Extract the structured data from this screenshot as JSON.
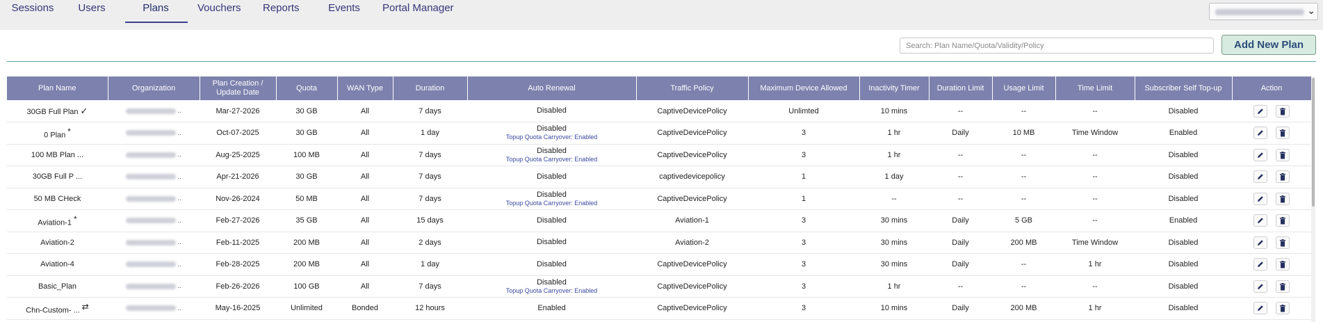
{
  "nav": {
    "tabs": [
      {
        "label": "Sessions",
        "active": false
      },
      {
        "label": "Users",
        "active": false
      },
      {
        "label": "Plans",
        "active": true
      },
      {
        "label": "Vouchers",
        "active": false
      },
      {
        "label": "Reports",
        "active": false
      },
      {
        "label": "Events",
        "active": false
      },
      {
        "label": "Portal Manager",
        "active": false
      }
    ],
    "org_select_icon": "chevron-down-icon"
  },
  "toolbar": {
    "search_placeholder": "Search: Plan Name/Quota/Validity/Policy",
    "add_label": "Add New Plan"
  },
  "colors": {
    "header_bg": "#7c81ad",
    "accent": "#3a3f8f",
    "add_button_bg": "#d8ebe1",
    "sub_text": "#3b4aa0"
  },
  "table": {
    "headers": [
      "Plan Name",
      "Organization",
      "Plan Creation / Update Date",
      "Quota",
      "WAN Type",
      "Duration",
      "Auto Renewal",
      "Traffic Policy",
      "Maximum Device Allowed",
      "Inactivity Timer",
      "Duration Limit",
      "Usage Limit",
      "Time Limit",
      "Subscriber Self Top-up",
      "Action"
    ],
    "rows": [
      {
        "name": "30GB Full Plan",
        "mark": "✓",
        "date": "Mar-27-2026",
        "quota": "30 GB",
        "wan": "All",
        "duration": "7 days",
        "renewal": "Disabled",
        "renewal_sub": "",
        "policy": "CaptiveDevicePolicy",
        "max_dev": "Unlimted",
        "inactivity": "10 mins",
        "dur_limit": "--",
        "usage": "--",
        "time_limit": "--",
        "topup": "Disabled"
      },
      {
        "name": "0 Plan",
        "mark": "*",
        "date": "Oct-07-2025",
        "quota": "30 GB",
        "wan": "All",
        "duration": "1 day",
        "renewal": "Disabled",
        "renewal_sub": "Topup Quota Carryover: Enabled",
        "policy": "CaptiveDevicePolicy",
        "max_dev": "3",
        "inactivity": "1 hr",
        "dur_limit": "Daily",
        "usage": "10 MB",
        "time_limit": "Time Window",
        "topup": "Enabled"
      },
      {
        "name": "100 MB Plan ...",
        "mark": "",
        "date": "Aug-25-2025",
        "quota": "100 MB",
        "wan": "All",
        "duration": "7 days",
        "renewal": "Disabled",
        "renewal_sub": "Topup Quota Carryover: Enabled",
        "policy": "CaptiveDevicePolicy",
        "max_dev": "3",
        "inactivity": "1 hr",
        "dur_limit": "--",
        "usage": "--",
        "time_limit": "--",
        "topup": "Disabled"
      },
      {
        "name": "30GB Full P ...",
        "mark": "",
        "date": "Apr-21-2026",
        "quota": "30 GB",
        "wan": "All",
        "duration": "7 days",
        "renewal": "Disabled",
        "renewal_sub": "",
        "policy": "captivedevicepolicy",
        "max_dev": "1",
        "inactivity": "1 day",
        "dur_limit": "--",
        "usage": "--",
        "time_limit": "--",
        "topup": "Disabled"
      },
      {
        "name": "50 MB CHeck",
        "mark": "",
        "date": "Nov-26-2024",
        "quota": "50 MB",
        "wan": "All",
        "duration": "7 days",
        "renewal": "Disabled",
        "renewal_sub": "Topup Quota Carryover: Enabled",
        "policy": "CaptiveDevicePolicy",
        "max_dev": "1",
        "inactivity": "--",
        "dur_limit": "--",
        "usage": "--",
        "time_limit": "--",
        "topup": "Disabled"
      },
      {
        "name": "Aviation-1",
        "mark": "*",
        "date": "Feb-27-2026",
        "quota": "35 GB",
        "wan": "All",
        "duration": "15 days",
        "renewal": "Disabled",
        "renewal_sub": "",
        "policy": "Aviation-1",
        "max_dev": "3",
        "inactivity": "30 mins",
        "dur_limit": "Daily",
        "usage": "5 GB",
        "time_limit": "--",
        "topup": "Enabled"
      },
      {
        "name": "Aviation-2",
        "mark": "",
        "date": "Feb-11-2025",
        "quota": "200 MB",
        "wan": "All",
        "duration": "2 days",
        "renewal": "Disabled",
        "renewal_sub": "",
        "policy": "Aviation-2",
        "max_dev": "3",
        "inactivity": "30 mins",
        "dur_limit": "Daily",
        "usage": "200 MB",
        "time_limit": "Time Window",
        "topup": "Disabled"
      },
      {
        "name": "Aviation-4",
        "mark": "",
        "date": "Feb-28-2025",
        "quota": "200 MB",
        "wan": "All",
        "duration": "1 day",
        "renewal": "Disabled",
        "renewal_sub": "",
        "policy": "CaptiveDevicePolicy",
        "max_dev": "3",
        "inactivity": "30 mins",
        "dur_limit": "Daily",
        "usage": "--",
        "time_limit": "1 hr",
        "topup": "Disabled"
      },
      {
        "name": "Basic_Plan",
        "mark": "",
        "date": "Feb-26-2026",
        "quota": "100 GB",
        "wan": "All",
        "duration": "7 days",
        "renewal": "Disabled",
        "renewal_sub": "Topup Quota Carryover: Enabled",
        "policy": "CaptiveDevicePolicy",
        "max_dev": "3",
        "inactivity": "1 hr",
        "dur_limit": "--",
        "usage": "--",
        "time_limit": "--",
        "topup": "Disabled"
      },
      {
        "name": "Chn-Custom- ...",
        "mark": "⇄",
        "date": "May-16-2025",
        "quota": "Unlimited",
        "wan": "Bonded",
        "duration": "12 hours",
        "renewal": "Enabled",
        "renewal_sub": "",
        "policy": "CaptiveDevicePolicy",
        "max_dev": "3",
        "inactivity": "10 mins",
        "dur_limit": "Daily",
        "usage": "200 MB",
        "time_limit": "1 hr",
        "topup": "Disabled"
      }
    ],
    "org_dots": "..",
    "action_icons": [
      "pencil-icon",
      "trash-icon"
    ]
  }
}
